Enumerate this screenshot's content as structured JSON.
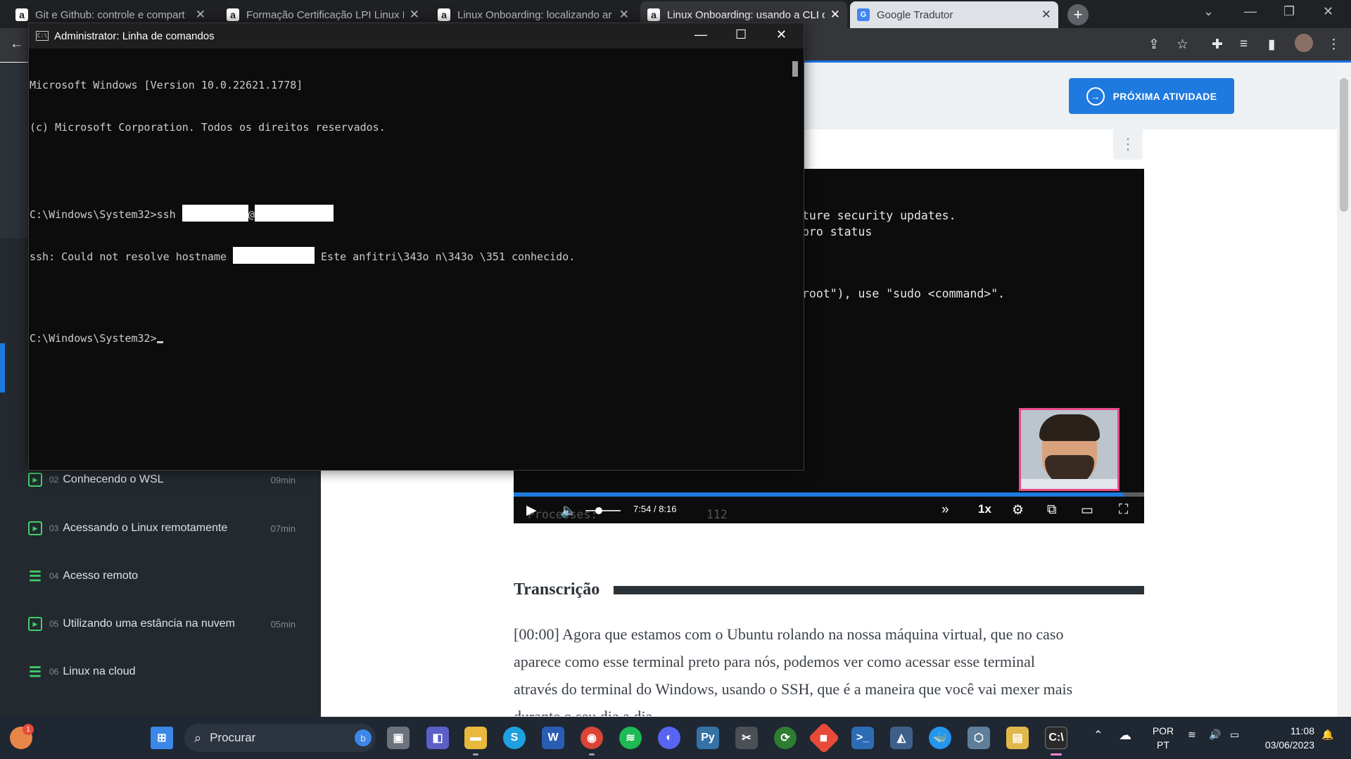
{
  "browser": {
    "tabs": [
      {
        "title": "Git e Github: controle e compart",
        "favicon": "a",
        "state": "inactive"
      },
      {
        "title": "Formação Certificação LPI Linux E",
        "favicon": "a",
        "state": "inactive"
      },
      {
        "title": "Linux Onboarding: localizando ar",
        "favicon": "a",
        "state": "inactive"
      },
      {
        "title": "Linux Onboarding: usando a CLI c",
        "favicon": "a",
        "state": "active"
      },
      {
        "title": "Google Tradutor",
        "favicon": "G",
        "state": "light"
      }
    ],
    "new_tab_label": "+",
    "close_glyph": "✕"
  },
  "page": {
    "next_button": "PRÓXIMA ATIVIDADE",
    "lessons": [
      {
        "num": "02",
        "title": "Conhecendo o WSL",
        "duration": "09min",
        "icon": "video-icon"
      },
      {
        "num": "03",
        "title": "Acessando o Linux remotamente",
        "duration": "07min",
        "icon": "video-icon"
      },
      {
        "num": "04",
        "title": "Acesso remoto",
        "duration": "",
        "icon": "list-icon"
      },
      {
        "num": "05",
        "title": "Utilizando uma estância na nuvem",
        "duration": "05min",
        "icon": "video-icon"
      },
      {
        "num": "06",
        "title": "Linux na cloud",
        "duration": "",
        "icon": "list-icon"
      }
    ],
    "video": {
      "lines": [
        "ture security updates.",
        "pro status",
        "root\"), use \"sudo <command>\"."
      ],
      "under_text": "Processes:",
      "under_value": "112",
      "current_time": "7:54",
      "separator": "/",
      "total_time": "8:16",
      "speed": "1x",
      "progress_fraction": 0.966
    },
    "transcript_title": "Transcrição",
    "transcript_text": "[00:00] Agora que estamos com o Ubuntu rolando na nossa máquina virtual, que no caso aparece como esse terminal preto para nós, podemos ver como acessar esse terminal através do terminal do Windows, usando o SSH, que é a maneira que você vai mexer mais durante o seu dia a dia."
  },
  "cmd": {
    "title": "Administrator: Linha de comandos",
    "lines": [
      "Microsoft Windows [Version 10.0.22621.1778]",
      "(c) Microsoft Corporation. Todos os direitos reservados.",
      "",
      "C:\\Windows\\System32>ssh ",
      "ssh: Could not resolve hostname ",
      " Este anfitri\\343o n\\343o \\351 conhecido.",
      "",
      "C:\\Windows\\System32>"
    ],
    "at_sign": "@"
  },
  "taskbar": {
    "search_placeholder": "Procurar",
    "notification_count": "1",
    "lang_line1": "POR",
    "lang_line2": "PT",
    "time": "11:08",
    "date": "03/06/2023"
  },
  "colors": {
    "accent": "#1f7ae0",
    "sidebar": "#23292f",
    "cmd_bg": "#0c0c0c",
    "lesson_icon": "#3ecf6a"
  }
}
